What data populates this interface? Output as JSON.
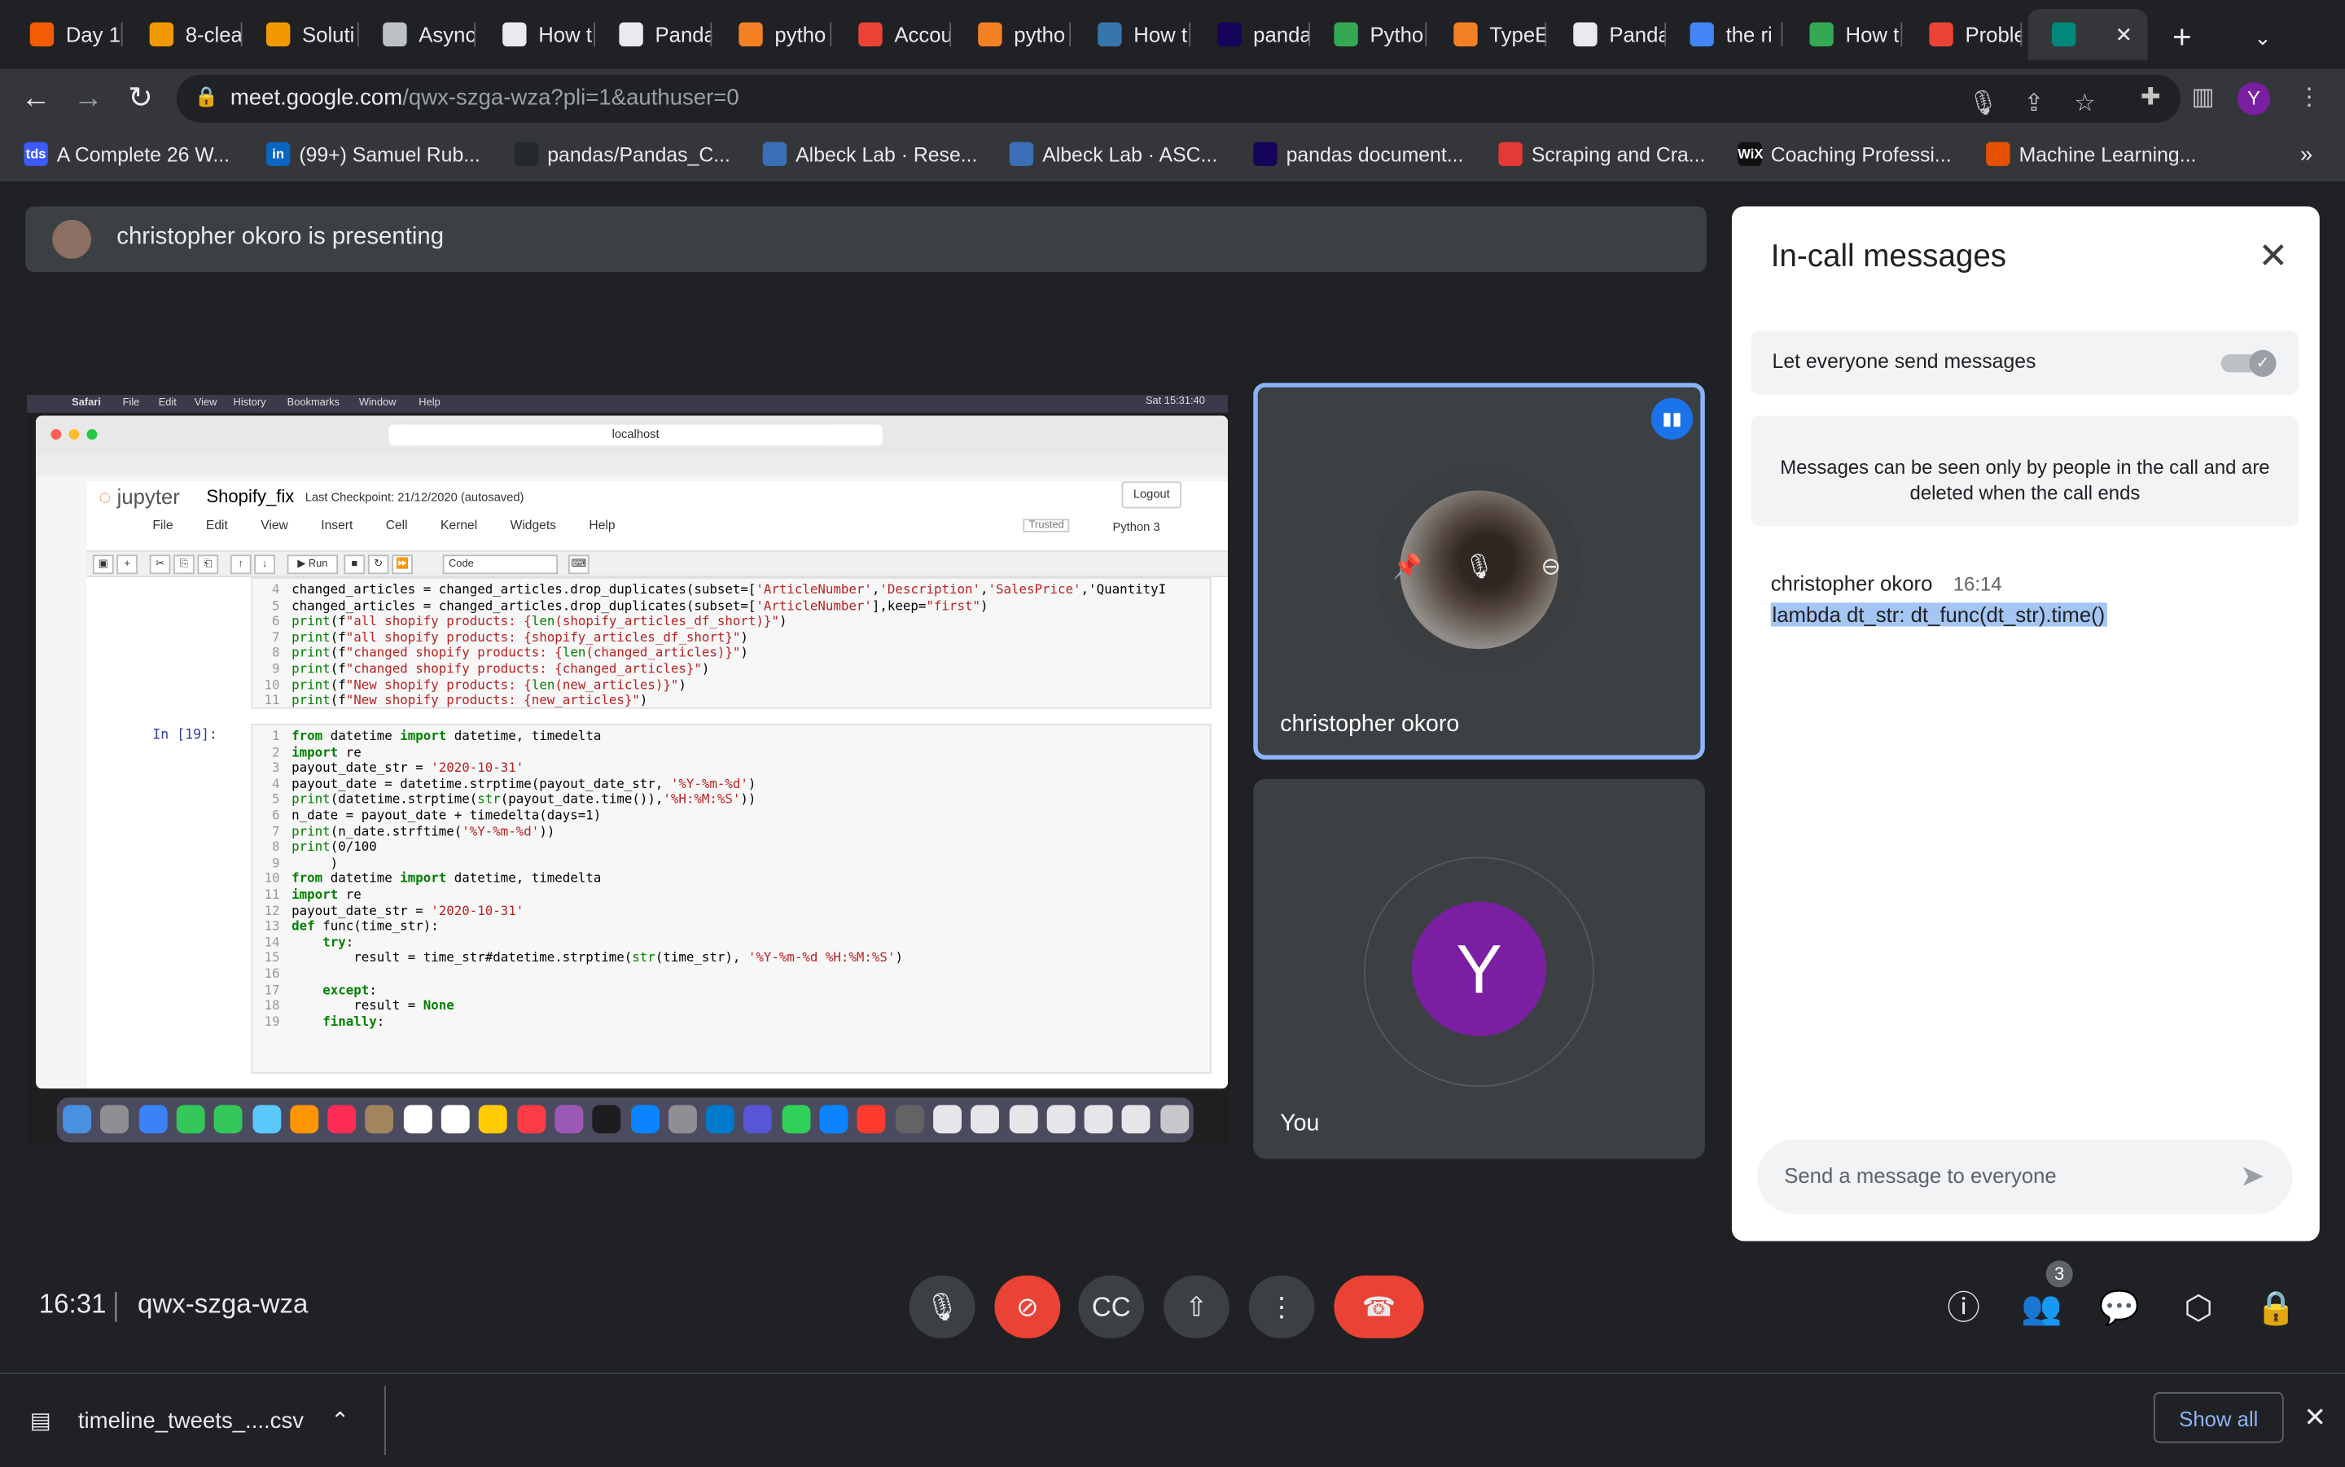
{
  "browser": {
    "tabs": [
      {
        "title": "Day 1",
        "color": "#f25c05"
      },
      {
        "title": "8-clea",
        "color": "#f29900"
      },
      {
        "title": "Soluti",
        "color": "#f29900"
      },
      {
        "title": "Async",
        "color": "#bdc1c6"
      },
      {
        "title": "How t",
        "color": "#e8eaed"
      },
      {
        "title": "Panda",
        "color": "#e8eaed"
      },
      {
        "title": "pytho",
        "color": "#f48024"
      },
      {
        "title": "Accou",
        "color": "#ea4335"
      },
      {
        "title": "pytho",
        "color": "#f48024"
      },
      {
        "title": "How t",
        "color": "#3776ab"
      },
      {
        "title": "panda",
        "color": "#150458"
      },
      {
        "title": "Pytho",
        "color": "#34a853"
      },
      {
        "title": "TypeE",
        "color": "#f48024"
      },
      {
        "title": "Panda",
        "color": "#e8eaed"
      },
      {
        "title": "the ri",
        "color": "#4285f4"
      },
      {
        "title": "How t",
        "color": "#34a853"
      },
      {
        "title": "Proble",
        "color": "#ea4335"
      },
      {
        "title": "",
        "color": "#00897b"
      }
    ],
    "url_host": "meet.google.com",
    "url_path": "/qwx-szga-wza?pli=1&authuser=0",
    "profile_initial": "Y",
    "bookmarks": [
      {
        "label": "A Complete 26 W...",
        "icon": "tds",
        "color": "#3d5afe"
      },
      {
        "label": "(99+) Samuel Rub...",
        "icon": "in",
        "color": "#0a66c2"
      },
      {
        "label": "pandas/Pandas_C...",
        "icon": "",
        "color": "#24292f"
      },
      {
        "label": "Albeck Lab · Rese...",
        "icon": "",
        "color": "#3b6fb6"
      },
      {
        "label": "Albeck Lab · ASC...",
        "icon": "",
        "color": "#3b6fb6"
      },
      {
        "label": "pandas document...",
        "icon": "",
        "color": "#150458"
      },
      {
        "label": "Scraping and Cra...",
        "icon": "",
        "color": "#e53935"
      },
      {
        "label": "Coaching Professi...",
        "icon": "WiX",
        "color": "#111111"
      },
      {
        "label": "Machine Learning...",
        "icon": "",
        "color": "#e65100"
      }
    ],
    "more_bookmarks": "»"
  },
  "meet": {
    "presenting_banner": "christopher okoro is presenting",
    "participants": [
      {
        "name": "christopher okoro"
      },
      {
        "name": "You",
        "initial": "Y"
      }
    ],
    "meeting_time": "16:31",
    "meeting_code": "qwx-szga-wza",
    "people_count": "3"
  },
  "panel": {
    "title": "In-call messages",
    "toggle_label": "Let everyone send messages",
    "toggle_on": true,
    "info": "Messages can be seen only by people in the call and are deleted when the call ends",
    "messages": [
      {
        "sender": "christopher okoro",
        "time": "16:14",
        "text": "lambda dt_str: dt_func(dt_str).time()"
      }
    ],
    "input_placeholder": "Send a message to everyone"
  },
  "shared_screen": {
    "mac_menu": [
      "Safari",
      "File",
      "Edit",
      "View",
      "History",
      "Bookmarks",
      "Window",
      "Help"
    ],
    "mac_clock": "Sat 15:31:40",
    "address": "localhost",
    "jupyter_logo": "jupyter",
    "notebook_name": "Shopify_fix",
    "checkpoint": "Last Checkpoint: 21/12/2020  (autosaved)",
    "logout": "Logout",
    "menu": [
      "File",
      "Edit",
      "View",
      "Insert",
      "Cell",
      "Kernel",
      "Widgets",
      "Help"
    ],
    "trusted": "Trusted",
    "kernel": "Python 3",
    "run_label": "Run",
    "cell_type": "Code",
    "prompt": "In [19]:",
    "cell1_lines": [
      {
        "n": "4",
        "code": "changed_articles = changed_articles.drop_duplicates(subset=['ArticleNumber','Description','SalesPrice','QuantityI"
      },
      {
        "n": "5",
        "code": "changed_articles = changed_articles.drop_duplicates(subset=['ArticleNumber'],keep=\"first\")"
      },
      {
        "n": "6",
        "code": "print(f\"all shopify products: {len(shopify_articles_df_short)}\")"
      },
      {
        "n": "7",
        "code": "print(f\"all shopify products: {shopify_articles_df_short}\")"
      },
      {
        "n": "8",
        "code": "print(f\"changed shopify products: {len(changed_articles)}\")"
      },
      {
        "n": "9",
        "code": "print(f\"changed shopify products: {changed_articles}\")"
      },
      {
        "n": "10",
        "code": "print(f\"New shopify products: {len(new_articles)}\")"
      },
      {
        "n": "11",
        "code": "print(f\"New shopify products: {new_articles}\")"
      }
    ],
    "cell2_lines": [
      {
        "n": "1",
        "code": "from datetime import datetime, timedelta"
      },
      {
        "n": "2",
        "code": "import re"
      },
      {
        "n": "3",
        "code": "payout_date_str = '2020-10-31'"
      },
      {
        "n": "4",
        "code": "payout_date = datetime.strptime(payout_date_str, '%Y-%m-%d')"
      },
      {
        "n": "5",
        "code": "print(datetime.strptime(str(payout_date.time()),'%H:%M:%S'))"
      },
      {
        "n": "6",
        "code": "n_date = payout_date + timedelta(days=1)"
      },
      {
        "n": "7",
        "code": "print(n_date.strftime('%Y-%m-%d'))"
      },
      {
        "n": "8",
        "code": "print(0/100"
      },
      {
        "n": "9",
        "code": "     )"
      },
      {
        "n": "10",
        "code": "from datetime import datetime, timedelta"
      },
      {
        "n": "11",
        "code": "import re"
      },
      {
        "n": "12",
        "code": "payout_date_str = '2020-10-31'"
      },
      {
        "n": "13",
        "code": "def func(time_str):"
      },
      {
        "n": "14",
        "code": "    try:"
      },
      {
        "n": "15",
        "code": "        result = time_str#datetime.strptime(str(time_str), '%Y-%m-%d %H:%M:%S')"
      },
      {
        "n": "16",
        "code": ""
      },
      {
        "n": "17",
        "code": "    except:"
      },
      {
        "n": "18",
        "code": "        result = None"
      },
      {
        "n": "19",
        "code": "    finally:"
      }
    ]
  },
  "downloads": {
    "file": "timeline_tweets_....csv",
    "show_all": "Show all"
  },
  "colors": {
    "accent_blue": "#8ab4f8",
    "end_call_red": "#ea4335",
    "avatar_purple": "#7b1fa2"
  }
}
